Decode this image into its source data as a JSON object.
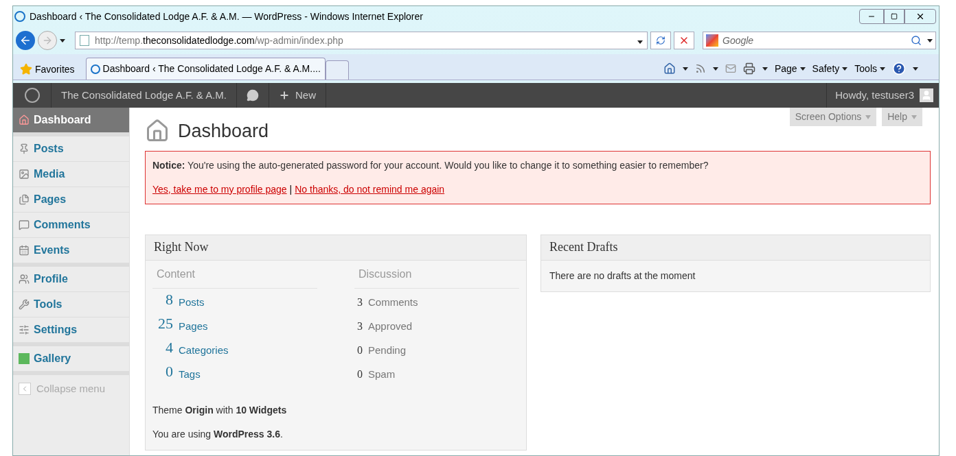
{
  "window": {
    "title": "Dashboard ‹ The Consolidated Lodge A.F. & A.M. — WordPress - Windows Internet Explorer"
  },
  "address_bar": {
    "prefix": "http://temp.",
    "domain": "theconsolidatedlodge.com",
    "path": "/wp-admin/index.php"
  },
  "search": {
    "placeholder": "Google"
  },
  "favorites": "Favorites",
  "tabs": [
    {
      "label": "Dashboard ‹ The Consolidated Lodge A.F. & A.M....",
      "selected": true
    }
  ],
  "command_bar": [
    "Page",
    "Safety",
    "Tools"
  ],
  "admin_bar": {
    "site": "The Consolidated Lodge A.F. & A.M.",
    "new": "New",
    "howdy": "Howdy, testuser3"
  },
  "sidebar": {
    "groups": [
      [
        {
          "label": "Dashboard",
          "selected": true
        }
      ],
      [
        {
          "label": "Posts",
          "selected": false
        },
        {
          "label": "Media",
          "selected": false
        },
        {
          "label": "Pages",
          "selected": false
        },
        {
          "label": "Comments",
          "selected": false
        },
        {
          "label": "Events",
          "selected": false
        }
      ],
      [
        {
          "label": "Profile",
          "selected": false
        },
        {
          "label": "Tools",
          "selected": false
        },
        {
          "label": "Settings",
          "selected": false
        }
      ],
      [
        {
          "label": "Gallery",
          "selected": false
        }
      ]
    ],
    "collapse": "Collapse menu"
  },
  "page": {
    "title": "Dashboard",
    "screen_options": "Screen Options",
    "help": "Help"
  },
  "notice": {
    "text": "**Notice:** You're using the auto-generated password for your account. Would you like to change it to something easier to remember?",
    "links": [
      "Yes, take me to my profile page",
      "No thanks, do not remind me again"
    ],
    "separator": "|"
  },
  "right_now": {
    "title": "Right Now",
    "content": {
      "heading": "Content",
      "rows": [
        {
          "count": "8",
          "label": "Posts"
        },
        {
          "count": "25",
          "label": "Pages"
        },
        {
          "count": "4",
          "label": "Categories"
        },
        {
          "count": "0",
          "label": "Tags"
        }
      ]
    },
    "discussion": {
      "heading": "Discussion",
      "rows": [
        {
          "count": "3",
          "label": "Comments"
        },
        {
          "count": "3",
          "label": "Approved"
        },
        {
          "count": "0",
          "label": "Pending"
        },
        {
          "count": "0",
          "label": "Spam"
        }
      ]
    },
    "theme": "Theme **Origin** with **10 Widgets**",
    "version": "You are using **WordPress 3.6**."
  },
  "recent_drafts": {
    "title": "Recent Drafts",
    "text": "There are no drafts at the moment"
  }
}
